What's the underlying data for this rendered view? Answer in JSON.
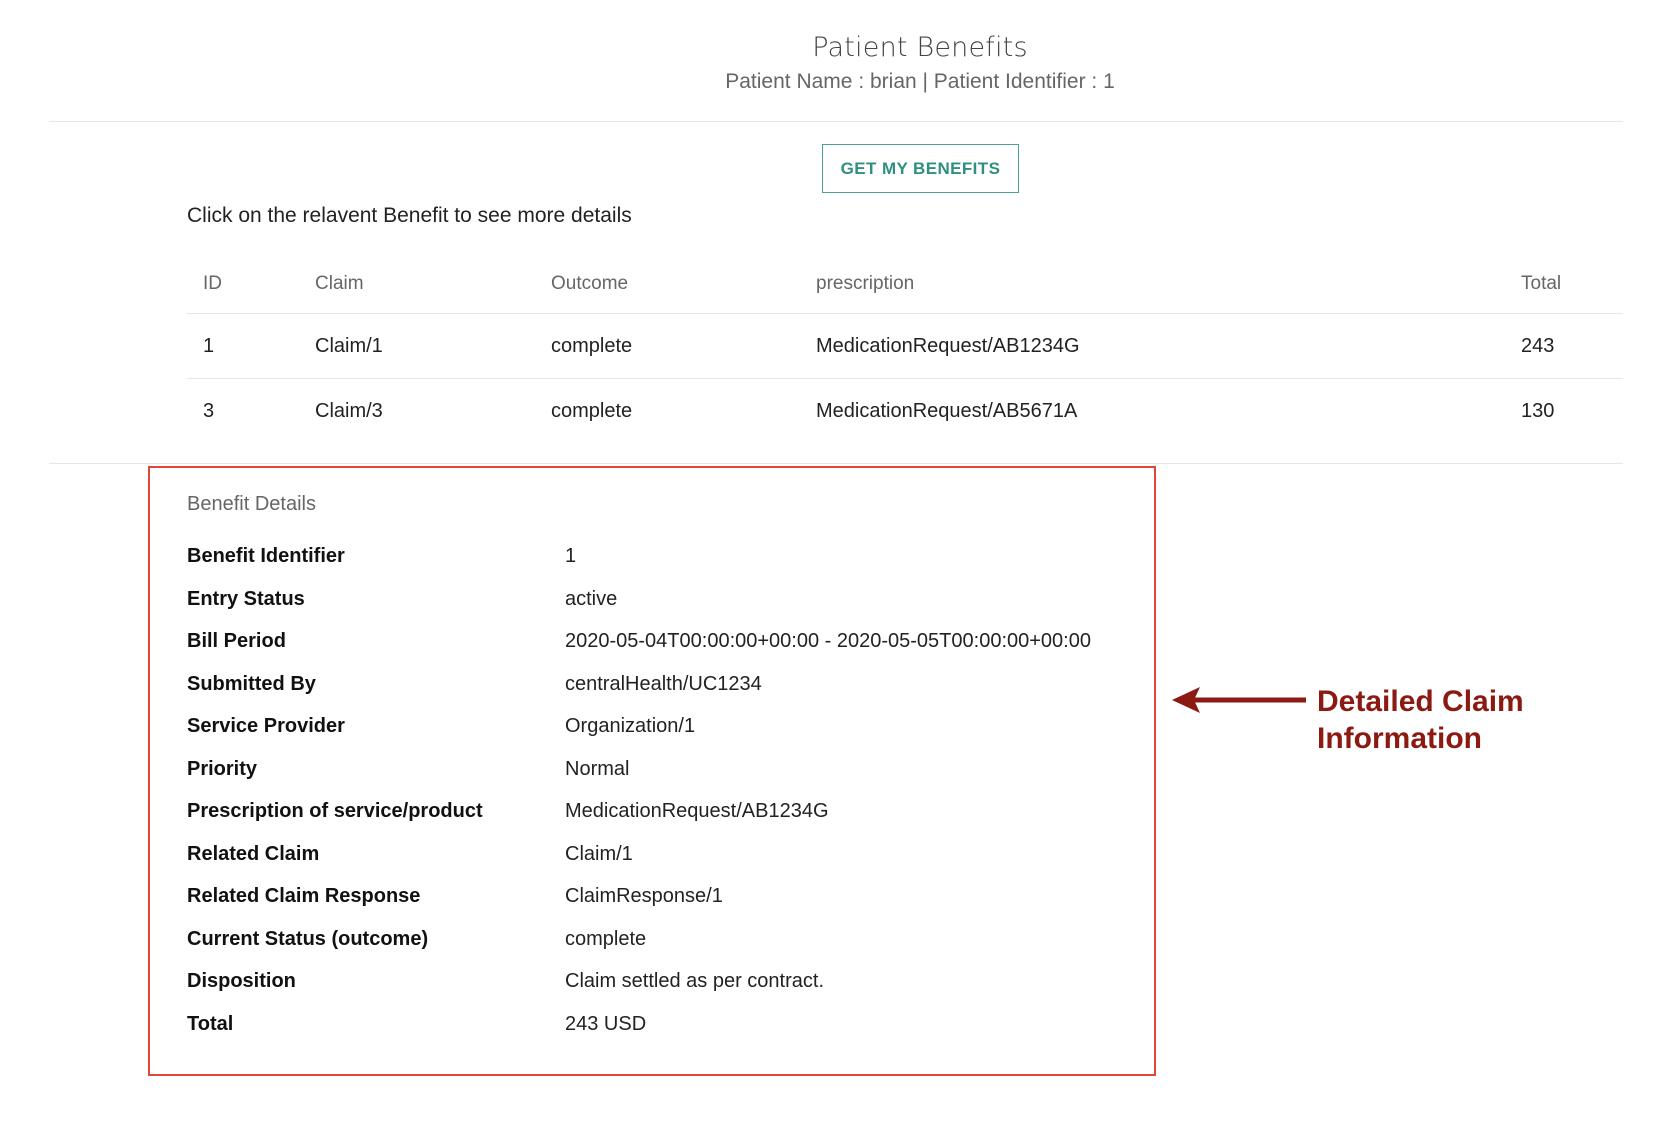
{
  "header": {
    "title": "Patient Benefits",
    "patient_info": "Patient Name : brian | Patient Identifier : 1"
  },
  "actions": {
    "get_benefits_label": "GET MY BENEFITS"
  },
  "instruction": "Click on the relavent Benefit to see more details",
  "benefits_table": {
    "columns": [
      "ID",
      "Claim",
      "Outcome",
      "prescription",
      "Total"
    ],
    "rows": [
      {
        "id": "1",
        "claim": "Claim/1",
        "outcome": "complete",
        "prescription": "MedicationRequest/AB1234G",
        "total": "243"
      },
      {
        "id": "3",
        "claim": "Claim/3",
        "outcome": "complete",
        "prescription": "MedicationRequest/AB5671A",
        "total": "130"
      }
    ]
  },
  "benefit_details": {
    "title": "Benefit Details",
    "fields": [
      {
        "label": "Benefit Identifier",
        "value": "1"
      },
      {
        "label": "Entry Status",
        "value": "active"
      },
      {
        "label": "Bill Period",
        "value": "2020-05-04T00:00:00+00:00 - 2020-05-05T00:00:00+00:00"
      },
      {
        "label": "Submitted By",
        "value": "centralHealth/UC1234"
      },
      {
        "label": "Service Provider",
        "value": "Organization/1"
      },
      {
        "label": "Priority",
        "value": "Normal"
      },
      {
        "label": "Prescription of service/product",
        "value": "MedicationRequest/AB1234G"
      },
      {
        "label": "Related Claim",
        "value": "Claim/1"
      },
      {
        "label": "Related Claim Response",
        "value": "ClaimResponse/1"
      },
      {
        "label": "Current Status (outcome)",
        "value": "complete"
      },
      {
        "label": "Disposition",
        "value": "Claim settled as per contract."
      },
      {
        "label": "Total",
        "value": "243 USD"
      }
    ]
  },
  "annotation": {
    "line1": "Detailed Claim",
    "line2": "Information",
    "color": "#8b1a12",
    "box_color": "#e0473a"
  },
  "colors": {
    "accent": "#2f8f80"
  }
}
